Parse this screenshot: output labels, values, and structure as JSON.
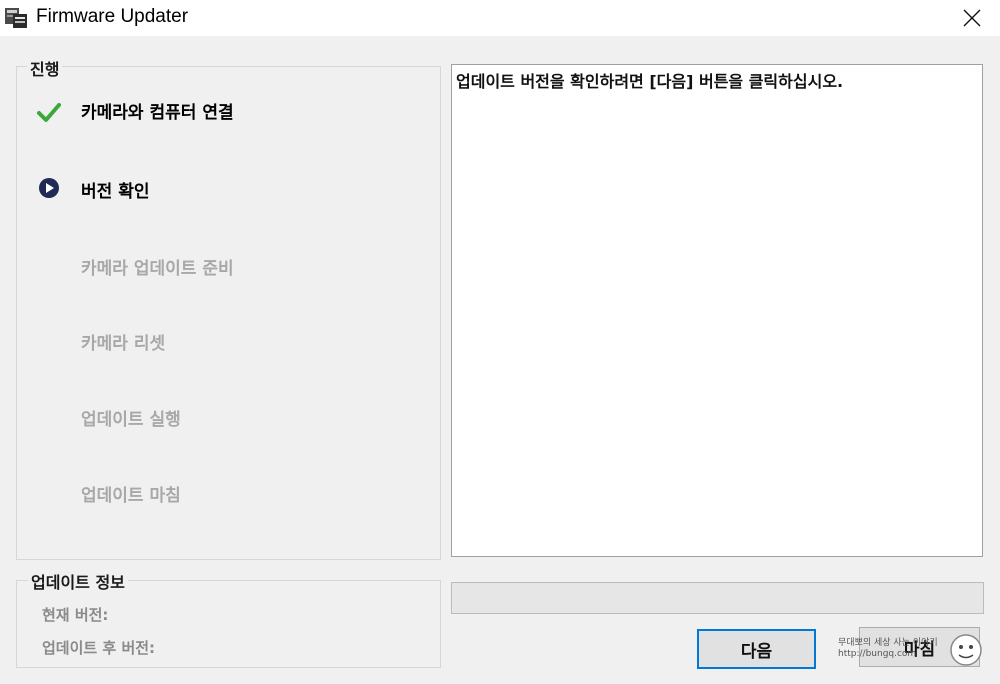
{
  "window": {
    "title": "Firmware Updater"
  },
  "progress_group": {
    "legend": "진행",
    "steps": [
      {
        "label": "카메라와 컴퓨터 연결",
        "state": "done",
        "icon": "checkmark-icon"
      },
      {
        "label": "버전 확인",
        "state": "current",
        "icon": "play-circle-icon"
      },
      {
        "label": "카메라 업데이트 준비",
        "state": "pending"
      },
      {
        "label": "카메라 리셋",
        "state": "pending"
      },
      {
        "label": "업데이트 실행",
        "state": "pending"
      },
      {
        "label": "업데이트 마침",
        "state": "pending"
      }
    ]
  },
  "update_info": {
    "legend": "업데이트 정보",
    "current_version_label": "현재 버전:",
    "after_version_label": "업데이트 후 버전:"
  },
  "message": "업데이트 버전을 확인하려면 [다음] 버튼을 클릭하십시오.",
  "progress": {
    "value": 0
  },
  "buttons": {
    "next": "다음",
    "finish": "마침"
  },
  "watermark": {
    "line1": "무대뽀의 세상 사는 이야기",
    "line2": "http://bungq.com"
  },
  "colors": {
    "accent": "#0078d7",
    "check": "#3aa93a",
    "current_icon": "#1f2a56"
  }
}
